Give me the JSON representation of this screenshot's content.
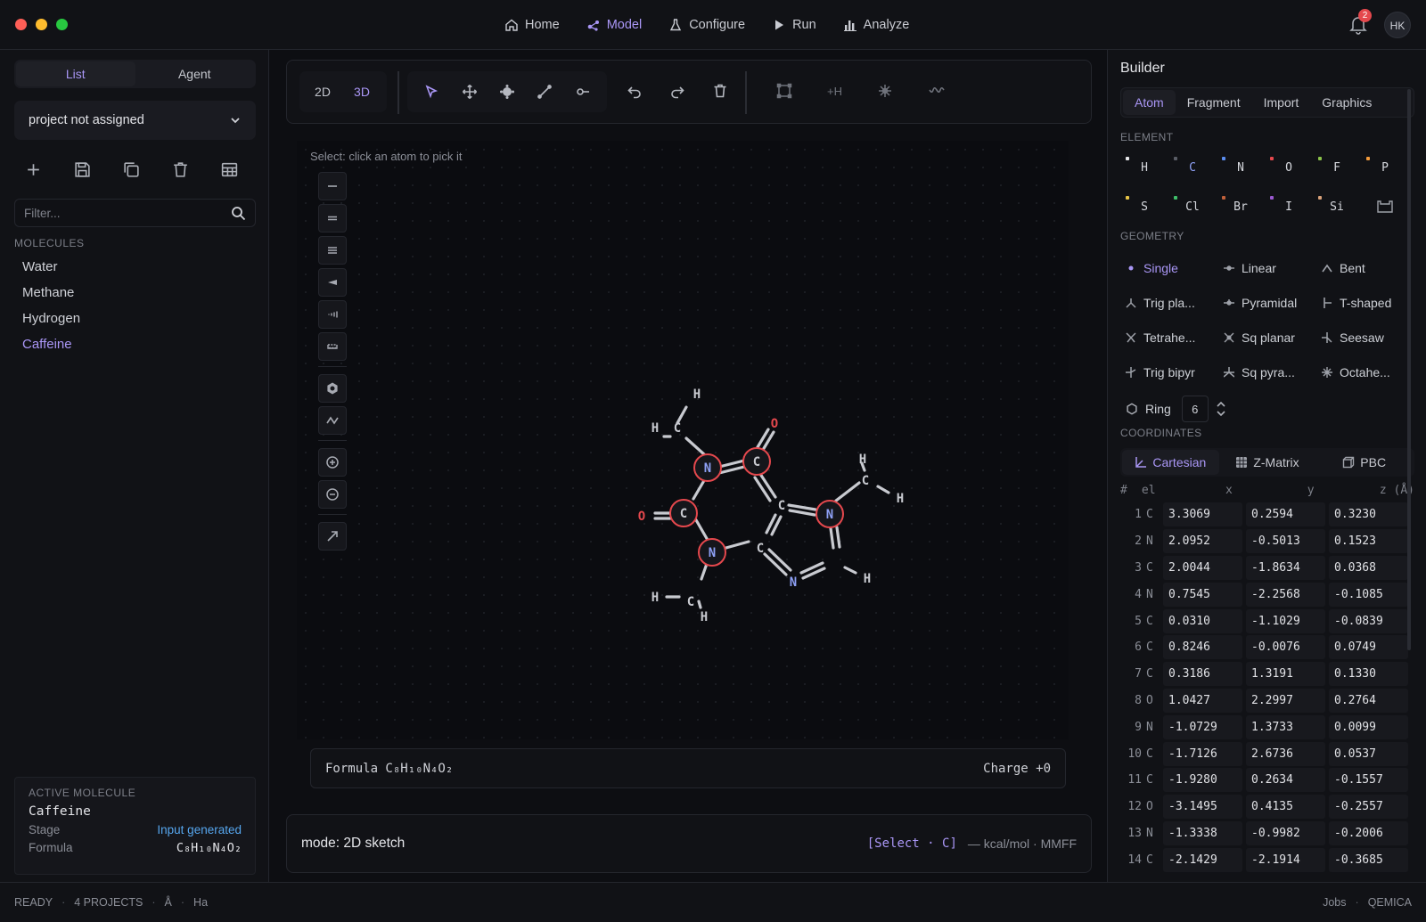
{
  "nav": {
    "items": [
      {
        "label": "Home",
        "icon": "home-icon"
      },
      {
        "label": "Model",
        "icon": "model-icon",
        "active": true
      },
      {
        "label": "Configure",
        "icon": "flask-icon"
      },
      {
        "label": "Run",
        "icon": "play-icon"
      },
      {
        "label": "Analyze",
        "icon": "bar-chart-icon"
      }
    ],
    "notifications": "2",
    "avatar": "HK"
  },
  "left": {
    "tabs": [
      "List",
      "Agent"
    ],
    "project": "project not assigned",
    "filter_placeholder": "Filter...",
    "molecules_label": "MOLECULES",
    "molecules": [
      "Water",
      "Methane",
      "Hydrogen",
      "Caffeine"
    ],
    "active_label": "ACTIVE MOLECULE",
    "active_name": "Caffeine",
    "stage_label": "Stage",
    "stage_value": "Input generated",
    "formula_label": "Formula",
    "formula_value": "C₈H₁₀N₄O₂"
  },
  "toolbar": {
    "dim2d": "2D",
    "dim3d": "3D",
    "add_h": "+H"
  },
  "canvas": {
    "hint": "Select: click an atom to pick it",
    "formula": "Formula C₈H₁₀N₄O₂",
    "charge": "Charge +0",
    "mode": "mode: 2D sketch",
    "selection": "[Select · C]",
    "energy": "— kcal/mol · MMFF",
    "atoms": [
      {
        "s": "H"
      },
      {
        "s": "H"
      },
      {
        "s": "C"
      },
      {
        "s": "O"
      },
      {
        "s": "N"
      },
      {
        "s": "C"
      },
      {
        "s": "H"
      },
      {
        "s": "C"
      },
      {
        "s": "H"
      },
      {
        "s": "N"
      },
      {
        "s": "C"
      },
      {
        "s": "O"
      },
      {
        "s": "C"
      },
      {
        "s": "N"
      },
      {
        "s": "C"
      },
      {
        "s": "H"
      },
      {
        "s": "N"
      },
      {
        "s": "H"
      },
      {
        "s": "C"
      },
      {
        "s": "H"
      }
    ]
  },
  "builder": {
    "title": "Builder",
    "tabs": [
      "Atom",
      "Fragment",
      "Import",
      "Graphics"
    ],
    "element_label": "ELEMENT",
    "elements": [
      {
        "s": "H",
        "c": "#e6e7ea"
      },
      {
        "s": "C",
        "c": "#5a5d66",
        "active": true
      },
      {
        "s": "N",
        "c": "#5b8def"
      },
      {
        "s": "O",
        "c": "#e5484d"
      },
      {
        "s": "F",
        "c": "#8bc34a"
      },
      {
        "s": "P",
        "c": "#f39a3a"
      },
      {
        "s": "S",
        "c": "#e8c547"
      },
      {
        "s": "Cl",
        "c": "#3fbf6a"
      },
      {
        "s": "Br",
        "c": "#c0603a"
      },
      {
        "s": "I",
        "c": "#9b59d0"
      },
      {
        "s": "Si",
        "c": "#d9a27a"
      }
    ],
    "geometry_label": "GEOMETRY",
    "geometries": [
      {
        "label": "Single",
        "icon": "dot-icon",
        "active": true
      },
      {
        "label": "Linear",
        "icon": "linear-icon"
      },
      {
        "label": "Bent",
        "icon": "bent-icon"
      },
      {
        "label": "Trig pla...",
        "icon": "trigonal-planar-icon"
      },
      {
        "label": "Pyramidal",
        "icon": "pyramidal-icon"
      },
      {
        "label": "T-shaped",
        "icon": "t-shaped-icon"
      },
      {
        "label": "Tetrahe...",
        "icon": "tetrahedral-icon"
      },
      {
        "label": "Sq planar",
        "icon": "square-planar-icon"
      },
      {
        "label": "Seesaw",
        "icon": "seesaw-icon"
      },
      {
        "label": "Trig bipyr",
        "icon": "trigonal-bipyramidal-icon"
      },
      {
        "label": "Sq pyra...",
        "icon": "square-pyramidal-icon"
      },
      {
        "label": "Octahe...",
        "icon": "octahedral-icon"
      }
    ],
    "ring_label": "Ring",
    "ring_value": "6",
    "coordinates_label": "COORDINATES",
    "coord_tabs": [
      "Cartesian",
      "Z-Matrix",
      "PBC"
    ],
    "coord_headers": {
      "idx": "#",
      "el": "el",
      "x": "x",
      "y": "y",
      "z": "z (Å)"
    },
    "coords": [
      {
        "i": "1",
        "el": "C",
        "x": "3.3069",
        "y": "0.2594",
        "z": "0.3230"
      },
      {
        "i": "2",
        "el": "N",
        "x": "2.0952",
        "y": "-0.5013",
        "z": "0.1523"
      },
      {
        "i": "3",
        "el": "C",
        "x": "2.0044",
        "y": "-1.8634",
        "z": "0.0368"
      },
      {
        "i": "4",
        "el": "N",
        "x": "0.7545",
        "y": "-2.2568",
        "z": "-0.1085"
      },
      {
        "i": "5",
        "el": "C",
        "x": "0.0310",
        "y": "-1.1029",
        "z": "-0.0839"
      },
      {
        "i": "6",
        "el": "C",
        "x": "0.8246",
        "y": "-0.0076",
        "z": "0.0749"
      },
      {
        "i": "7",
        "el": "C",
        "x": "0.3186",
        "y": "1.3191",
        "z": "0.1330"
      },
      {
        "i": "8",
        "el": "O",
        "x": "1.0427",
        "y": "2.2997",
        "z": "0.2764"
      },
      {
        "i": "9",
        "el": "N",
        "x": "-1.0729",
        "y": "1.3733",
        "z": "0.0099"
      },
      {
        "i": "10",
        "el": "C",
        "x": "-1.7126",
        "y": "2.6736",
        "z": "0.0537"
      },
      {
        "i": "11",
        "el": "C",
        "x": "-1.9280",
        "y": "0.2634",
        "z": "-0.1557"
      },
      {
        "i": "12",
        "el": "O",
        "x": "-3.1495",
        "y": "0.4135",
        "z": "-0.2557"
      },
      {
        "i": "13",
        "el": "N",
        "x": "-1.3338",
        "y": "-0.9982",
        "z": "-0.2006"
      },
      {
        "i": "14",
        "el": "C",
        "x": "-2.1429",
        "y": "-2.1914",
        "z": "-0.3685"
      }
    ]
  },
  "status": {
    "ready": "READY",
    "projects": "4 PROJECTS",
    "unit1": "Å",
    "unit2": "Ha",
    "jobs": "Jobs",
    "app": "QEMICA"
  },
  "colors": {
    "accent": "#a996f5",
    "bg": "#0d0e12",
    "panel": "#111216",
    "oxygen": "#e5484d",
    "nitrogen": "#8ea0f5"
  }
}
